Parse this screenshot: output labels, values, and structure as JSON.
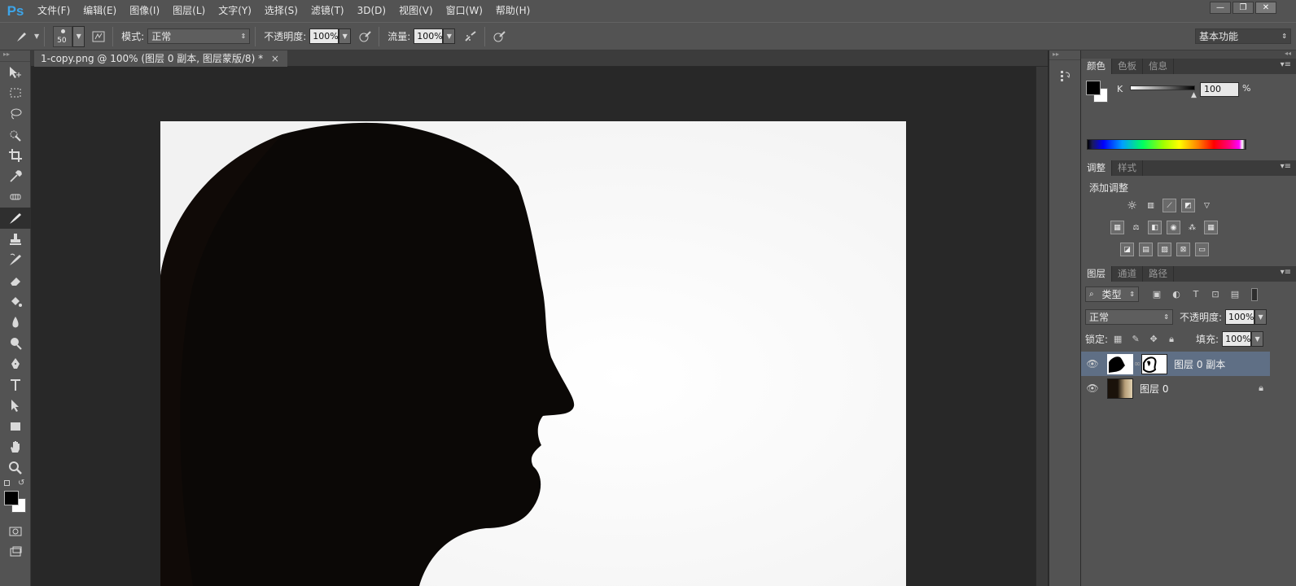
{
  "app": {
    "logo": "Ps"
  },
  "menu": [
    "文件(F)",
    "编辑(E)",
    "图像(I)",
    "图层(L)",
    "文字(Y)",
    "选择(S)",
    "滤镜(T)",
    "3D(D)",
    "视图(V)",
    "窗口(W)",
    "帮助(H)"
  ],
  "window_controls": {
    "minimize": "—",
    "restore": "❐",
    "close": "✕"
  },
  "options": {
    "brush_size": "50",
    "mode_label": "模式:",
    "mode_value": "正常",
    "opacity_label": "不透明度:",
    "opacity_value": "100%",
    "flow_label": "流量:",
    "flow_value": "100%",
    "workspace": "基本功能"
  },
  "document": {
    "tab_title": "1-copy.png @ 100% (图层 0 副本, 图层蒙版/8) *",
    "close": "×"
  },
  "color_panel": {
    "tabs": [
      "颜色",
      "色板",
      "信息"
    ],
    "channel_label": "K",
    "channel_value": "100",
    "unit": "%",
    "fg_color": "#000000",
    "bg_color": "#ffffff"
  },
  "adjust_panel": {
    "tabs": [
      "调整",
      "样式"
    ],
    "title": "添加调整"
  },
  "layers_panel": {
    "tabs": [
      "图层",
      "通道",
      "路径"
    ],
    "filter_kind": "类型",
    "blend_mode": "正常",
    "opacity_label": "不透明度:",
    "opacity_value": "100%",
    "lock_label": "锁定:",
    "fill_label": "填充:",
    "fill_value": "100%",
    "layers": [
      {
        "name": "图层 0 副本",
        "selected": true
      },
      {
        "name": "图层 0",
        "selected": false
      }
    ]
  },
  "accent_color": "#3da4e8",
  "icons": [
    "move-tool-icon",
    "marquee-tool-icon",
    "lasso-tool-icon",
    "quick-select-icon",
    "crop-tool-icon",
    "eyedropper-icon",
    "spot-heal-icon",
    "brush-tool-icon",
    "clone-stamp-icon",
    "history-brush-icon",
    "eraser-icon",
    "paint-bucket-icon",
    "blur-icon",
    "dodge-icon",
    "pen-tool-icon",
    "type-tool-icon",
    "path-select-icon",
    "rectangle-tool-icon",
    "hand-tool-icon",
    "zoom-tool-icon"
  ]
}
